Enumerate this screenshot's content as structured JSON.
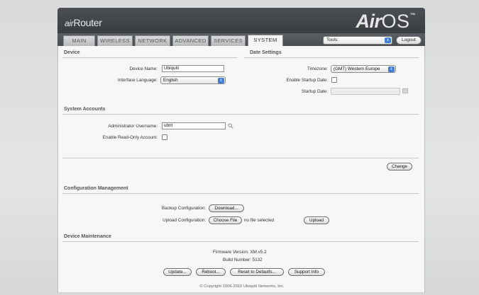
{
  "header": {
    "brand_air": "air",
    "brand_router": "Router",
    "logo_air": "Air",
    "logo_os": "OS",
    "logo_tm": "™"
  },
  "tabs": [
    {
      "label": "MAIN"
    },
    {
      "label": "WIRELESS"
    },
    {
      "label": "NETWORK"
    },
    {
      "label": "ADVANCED"
    },
    {
      "label": "SERVICES"
    },
    {
      "label": "SYSTEM",
      "active": true
    }
  ],
  "toolbar": {
    "tools_label": "Tools:",
    "logout_label": "Logout"
  },
  "device": {
    "section_title": "Device",
    "device_name_label": "Device Name:",
    "device_name_value": "Ubiquiti",
    "interface_language_label": "Interface Language:",
    "interface_language_value": "English"
  },
  "date_settings": {
    "section_title": "Date Settings",
    "timezone_label": "Timezone:",
    "timezone_value": "(GMT) Western Europe",
    "enable_startup_date_label": "Enable Startup Date:",
    "startup_date_label": "Startup Date:"
  },
  "system_accounts": {
    "section_title": "System Accounts",
    "admin_username_label": "Administrator Username:",
    "admin_username_value": "ubnt",
    "enable_readonly_label": "Enable Read-Only Account:",
    "change_label": "Change"
  },
  "config_management": {
    "section_title": "Configuration Management",
    "backup_label": "Backup Configuration:",
    "download_label": "Download...",
    "upload_label": "Upload Configuration:",
    "choose_file_label": "Choose File",
    "no_file_text": "no file selected",
    "upload_button_label": "Upload"
  },
  "device_maintenance": {
    "section_title": "Device Maintenance",
    "firmware_version_text": "Firmware Version: XM.v5.2",
    "build_number_text": "Build Number: 5132",
    "update_label": "Update...",
    "reboot_label": "Reboot...",
    "reset_label": "Reset to Defaults...",
    "support_label": "Support Info"
  },
  "footer": {
    "copyright": "© Copyright 2006-2010 Ubiquiti Networks, Inc."
  },
  "colors": {
    "header_bg": "#3f4246",
    "select_accent": "#3f7fd4",
    "content_bg": "#f7f7f7"
  }
}
